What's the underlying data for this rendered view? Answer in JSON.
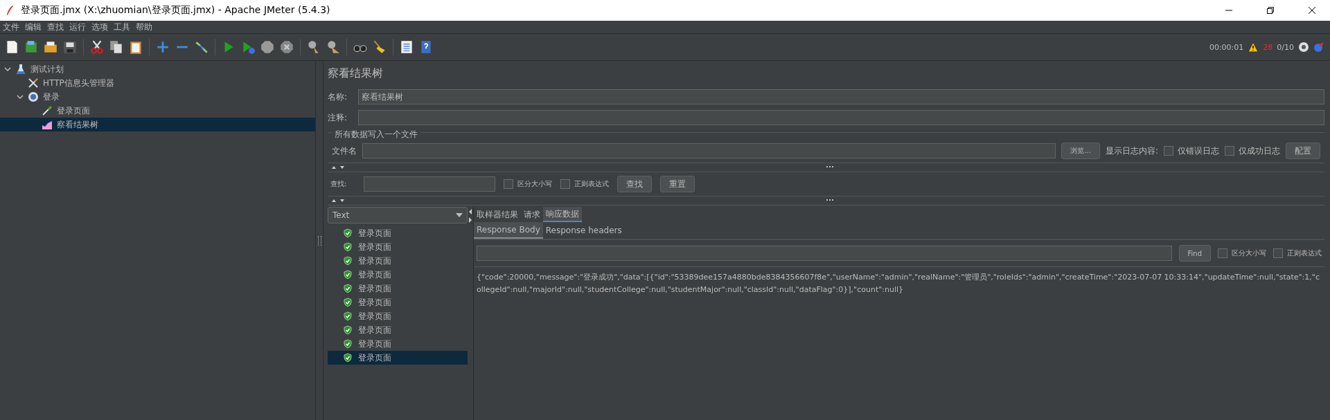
{
  "window": {
    "title": "登录页面.jmx (X:\\zhuomian\\登录页面.jmx) - Apache JMeter (5.4.3)"
  },
  "menu": [
    "文件",
    "编辑",
    "查找",
    "运行",
    "选项",
    "工具",
    "帮助"
  ],
  "status": {
    "elapsed": "00:00:01",
    "warnings": "28",
    "threads": "0/10"
  },
  "tree": [
    {
      "label": "测试计划",
      "kind": "plan",
      "expanded": true,
      "selected": false,
      "children": [
        {
          "label": "HTTP信息头管理器",
          "kind": "header",
          "selected": false
        },
        {
          "label": "登录",
          "kind": "thread",
          "expanded": true,
          "selected": false,
          "children": [
            {
              "label": "登录页面",
              "kind": "sampler",
              "selected": false
            },
            {
              "label": "察看结果树",
              "kind": "listener",
              "selected": true
            }
          ]
        }
      ]
    }
  ],
  "panel": {
    "title": "察看结果树",
    "name_label": "名称:",
    "name_value": "察看结果树",
    "comment_label": "注释:",
    "file_section": "所有数据写入一个文件",
    "file_label": "文件名",
    "browse": "浏览...",
    "log_label": "显示日志内容:",
    "log_checks": [
      {
        "label": "仅错误日志",
        "checked": false
      },
      {
        "label": "仅成功日志",
        "checked": false
      }
    ],
    "config": "配置"
  },
  "search": {
    "label": "查找:",
    "checks": [
      {
        "label": "区分大小写",
        "checked": false
      },
      {
        "label": "正则表达式",
        "checked": false
      }
    ],
    "find": "查找",
    "reset": "重置"
  },
  "renderer": "Text",
  "results": [
    {
      "label": "登录页面",
      "success": true,
      "selected": false
    },
    {
      "label": "登录页面",
      "success": true,
      "selected": false
    },
    {
      "label": "登录页面",
      "success": true,
      "selected": false
    },
    {
      "label": "登录页面",
      "success": true,
      "selected": false
    },
    {
      "label": "登录页面",
      "success": true,
      "selected": false
    },
    {
      "label": "登录页面",
      "success": true,
      "selected": false
    },
    {
      "label": "登录页面",
      "success": true,
      "selected": false
    },
    {
      "label": "登录页面",
      "success": true,
      "selected": false
    },
    {
      "label": "登录页面",
      "success": true,
      "selected": false
    },
    {
      "label": "登录页面",
      "success": true,
      "selected": true
    }
  ],
  "tabs": [
    {
      "label": "取样器结果",
      "selected": false
    },
    {
      "label": "请求",
      "selected": false
    },
    {
      "label": "响应数据",
      "selected": true
    }
  ],
  "subtabs": [
    {
      "label": "Response Body",
      "selected": true
    },
    {
      "label": "Response headers",
      "selected": false
    }
  ],
  "response_search": {
    "find": "Find",
    "checks": [
      {
        "label": "区分大小写",
        "checked": false
      },
      {
        "label": "正则表达式",
        "checked": false
      }
    ]
  },
  "response_body": "{\"code\":20000,\"message\":\"登录成功\",\"data\":[{\"id\":\"53389dee157a4880bde8384356607f8e\",\"userName\":\"admin\",\"realName\":\"管理员\",\"roleIds\":\"admin\",\"createTime\":\"2023-07-07 10:33:14\",\"updateTime\":null,\"state\":1,\"collegeId\":null,\"majorId\":null,\"studentCollege\":null,\"studentMajor\":null,\"classId\":null,\"dataFlag\":0}],\"count\":null}"
}
